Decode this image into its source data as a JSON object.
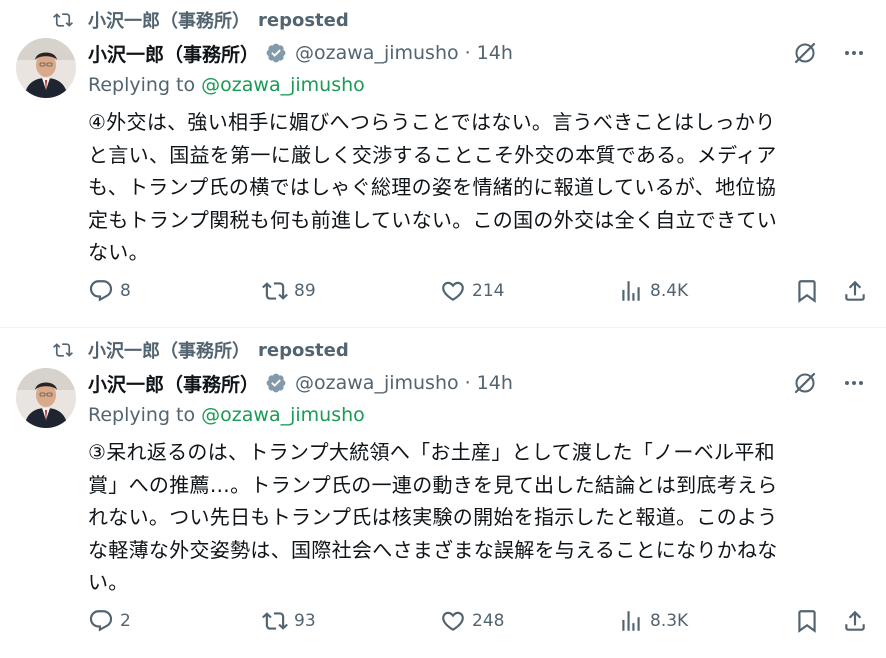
{
  "colors": {
    "accent": "#1d9bf0",
    "mention": "#1a9a55",
    "muted": "#536471",
    "text": "#0f1419"
  },
  "posts": [
    {
      "repost_by": "小沢一郎（事務所）",
      "repost_label": "reposted",
      "author": "小沢一郎（事務所）",
      "handle": "@ozawa_jimusho",
      "dot": "·",
      "time": "14h",
      "replying_label": "Replying to",
      "replying_to": "@ozawa_jimusho",
      "lines": [
        "④外交は、強い相手に媚びへつらうことではない。言うべきことはしっかり",
        "と言い、国益を第一に厳しく交渉することこそ外交の本質である。メディア",
        "も、トランプ氏の横ではしゃぐ総理の姿を情緒的に報道しているが、地位協",
        "定もトランプ関税も何も前進していない。この国の外交は全く自立できてい",
        "ない。"
      ],
      "replies": "8",
      "reposts": "89",
      "likes": "214",
      "views": "8.4K"
    },
    {
      "repost_by": "小沢一郎（事務所）",
      "repost_label": "reposted",
      "author": "小沢一郎（事務所）",
      "handle": "@ozawa_jimusho",
      "dot": "·",
      "time": "14h",
      "replying_label": "Replying to",
      "replying_to": "@ozawa_jimusho",
      "lines": [
        "③呆れ返るのは、トランプ大統領へ「お土産」として渡した「ノーベル平和",
        "賞」への推薦…。トランプ氏の一連の動きを見て出した結論とは到底考えら",
        "れない。つい先日もトランプ氏は核実験の開始を指示したと報道。このよう",
        "な軽薄な外交姿勢は、国際社会へさまざまな誤解を与えることになりかねな",
        "い。"
      ],
      "replies": "2",
      "reposts": "93",
      "likes": "248",
      "views": "8.3K"
    }
  ]
}
